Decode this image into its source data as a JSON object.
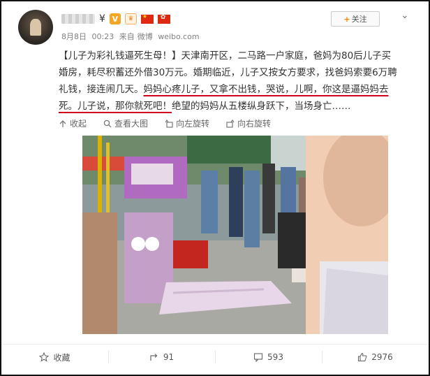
{
  "post": {
    "name_tail": "¥",
    "date": "8月8日",
    "time": "00:23",
    "source_prefix": "来自",
    "source": "微博",
    "domain": "weibo.com",
    "follow_label": "关注",
    "text_lines": [
      [
        "【儿子为彩礼钱逼死生母！】天津南开区，二马路一户家庭，爸妈为80后儿子买"
      ],
      [
        "婚房，耗尽积蓄还外借30万元。婚期临近，儿子又按女方要求，找爸妈索要6万聘"
      ],
      [
        "礼钱，接连闹几天。",
        "妈妈心疼儿子，又拿不出钱，哭说，儿啊，你这是逼妈妈去"
      ],
      [
        "死。",
        "儿子说，那你就死吧！",
        "绝望的妈妈从五楼纵身跃下，当场身亡……"
      ]
    ]
  },
  "toolbar": {
    "collapse_label": "收起",
    "view_large_label": "查看大图",
    "rotate_left_label": "向左旋转",
    "rotate_right_label": "向右旋转"
  },
  "footer": {
    "favorite_label": "收藏",
    "repost_count": "91",
    "comment_count": "593",
    "like_count": "2976"
  },
  "icons": [
    "avatar",
    "verified-v-icon",
    "vip-icon",
    "china-flag-icon",
    "hongkong-flag-icon",
    "chevron-down-icon",
    "collapse-icon",
    "search-icon",
    "rotate-left-icon",
    "rotate-right-icon",
    "star-icon",
    "repost-icon",
    "comment-icon",
    "like-icon"
  ],
  "colors": {
    "accent": "#ff8200",
    "link": "#eb7350",
    "underline": "#d0021b"
  }
}
